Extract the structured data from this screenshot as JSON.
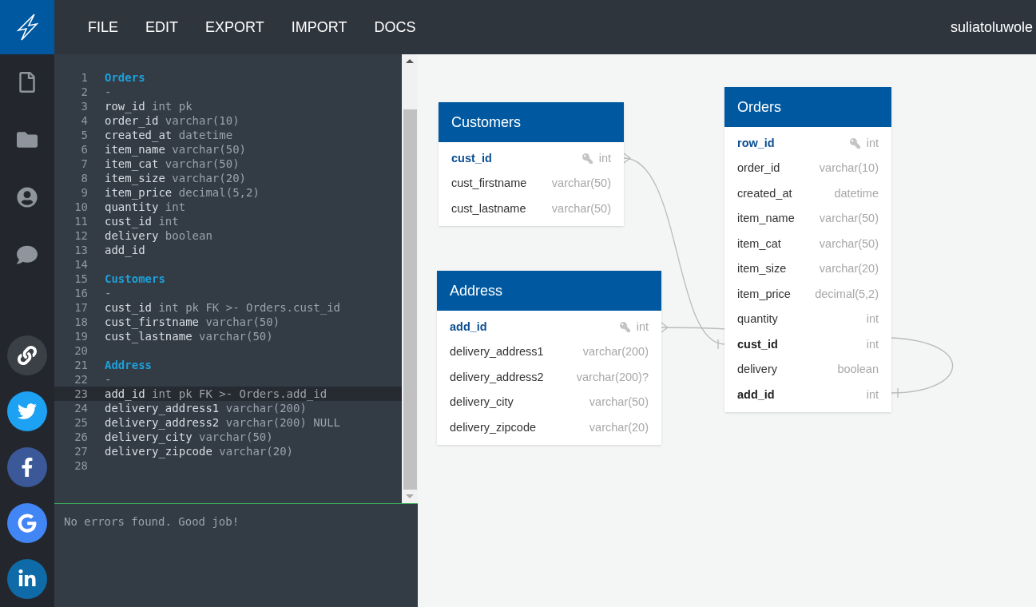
{
  "header": {
    "menu": [
      "FILE",
      "EDIT",
      "EXPORT",
      "IMPORT",
      "DOCS"
    ],
    "user": "suliatoluwole"
  },
  "editor": {
    "lines": [
      {
        "number": "1",
        "kind": "table",
        "text": "Orders",
        "active": false
      },
      {
        "number": "2",
        "kind": "dash",
        "text": "-",
        "active": false
      },
      {
        "number": "3",
        "kind": "field",
        "name": "row_id",
        "rest": "int pk",
        "active": false
      },
      {
        "number": "4",
        "kind": "field",
        "name": "order_id",
        "rest": "varchar(10)",
        "active": false
      },
      {
        "number": "5",
        "kind": "field",
        "name": "created_at",
        "rest": "datetime",
        "active": false
      },
      {
        "number": "6",
        "kind": "field",
        "name": "item_name",
        "rest": "varchar(50)",
        "active": false
      },
      {
        "number": "7",
        "kind": "field",
        "name": "item_cat",
        "rest": "varchar(50)",
        "active": false
      },
      {
        "number": "8",
        "kind": "field",
        "name": "item_size",
        "rest": "varchar(20)",
        "active": false
      },
      {
        "number": "9",
        "kind": "field",
        "name": "item_price",
        "rest": "decimal(5,2)",
        "active": false
      },
      {
        "number": "10",
        "kind": "field",
        "name": "quantity",
        "rest": "int",
        "active": false
      },
      {
        "number": "11",
        "kind": "field",
        "name": "cust_id",
        "rest": "int",
        "active": false
      },
      {
        "number": "12",
        "kind": "field",
        "name": "delivery",
        "rest": "boolean",
        "active": false
      },
      {
        "number": "13",
        "kind": "field",
        "name": "add_id",
        "active": false
      },
      {
        "number": "14",
        "kind": "blank",
        "active": false
      },
      {
        "number": "15",
        "kind": "table",
        "text": "Customers",
        "active": false
      },
      {
        "number": "16",
        "kind": "dash",
        "text": "-",
        "active": false
      },
      {
        "number": "17",
        "kind": "field",
        "name": "cust_id",
        "rest": "int pk FK >- Orders.cust_id",
        "active": false
      },
      {
        "number": "18",
        "kind": "field",
        "name": "cust_firstname",
        "rest": "varchar(50)",
        "active": false
      },
      {
        "number": "19",
        "kind": "field",
        "name": "cust_lastname",
        "rest": "varchar(50)",
        "active": false
      },
      {
        "number": "20",
        "kind": "blank",
        "active": false
      },
      {
        "number": "21",
        "kind": "table",
        "text": "Address",
        "active": false
      },
      {
        "number": "22",
        "kind": "dash",
        "text": "-",
        "active": false
      },
      {
        "number": "23",
        "kind": "field",
        "name": "add_id",
        "rest": "int pk FK >- Orders.add_id",
        "active": true
      },
      {
        "number": "24",
        "kind": "field",
        "name": "delivery_address1",
        "rest": "varchar(200)",
        "active": false
      },
      {
        "number": "25",
        "kind": "field",
        "name": "delivery_address2",
        "rest": "varchar(200) NULL",
        "active": false
      },
      {
        "number": "26",
        "kind": "field",
        "name": "delivery_city",
        "rest": "varchar(50)",
        "active": false
      },
      {
        "number": "27",
        "kind": "field",
        "name": "delivery_zipcode",
        "rest": "varchar(20)",
        "active": false
      },
      {
        "number": "28",
        "kind": "blank",
        "active": false
      }
    ],
    "status": "No errors found. Good job!"
  },
  "diagram": {
    "tables": [
      {
        "title": "Customers",
        "fields": [
          {
            "name": "cust_id",
            "type": "int",
            "kind": "pk"
          },
          {
            "name": "cust_firstname",
            "type": "varchar(50)",
            "kind": "plain"
          },
          {
            "name": "cust_lastname",
            "type": "varchar(50)",
            "kind": "plain"
          }
        ]
      },
      {
        "title": "Address",
        "fields": [
          {
            "name": "add_id",
            "type": "int",
            "kind": "pk"
          },
          {
            "name": "delivery_address1",
            "type": "varchar(200)",
            "kind": "plain"
          },
          {
            "name": "delivery_address2",
            "type": "varchar(200)?",
            "kind": "plain"
          },
          {
            "name": "delivery_city",
            "type": "varchar(50)",
            "kind": "plain"
          },
          {
            "name": "delivery_zipcode",
            "type": "varchar(20)",
            "kind": "plain"
          }
        ]
      },
      {
        "title": "Orders",
        "fields": [
          {
            "name": "row_id",
            "type": "int",
            "kind": "pk"
          },
          {
            "name": "order_id",
            "type": "varchar(10)",
            "kind": "plain"
          },
          {
            "name": "created_at",
            "type": "datetime",
            "kind": "plain"
          },
          {
            "name": "item_name",
            "type": "varchar(50)",
            "kind": "plain"
          },
          {
            "name": "item_cat",
            "type": "varchar(50)",
            "kind": "plain"
          },
          {
            "name": "item_size",
            "type": "varchar(20)",
            "kind": "plain"
          },
          {
            "name": "item_price",
            "type": "decimal(5,2)",
            "kind": "plain"
          },
          {
            "name": "quantity",
            "type": "int",
            "kind": "plain"
          },
          {
            "name": "cust_id",
            "type": "int",
            "kind": "fk"
          },
          {
            "name": "delivery",
            "type": "boolean",
            "kind": "plain"
          },
          {
            "name": "add_id",
            "type": "int",
            "kind": "fk"
          }
        ]
      }
    ]
  }
}
